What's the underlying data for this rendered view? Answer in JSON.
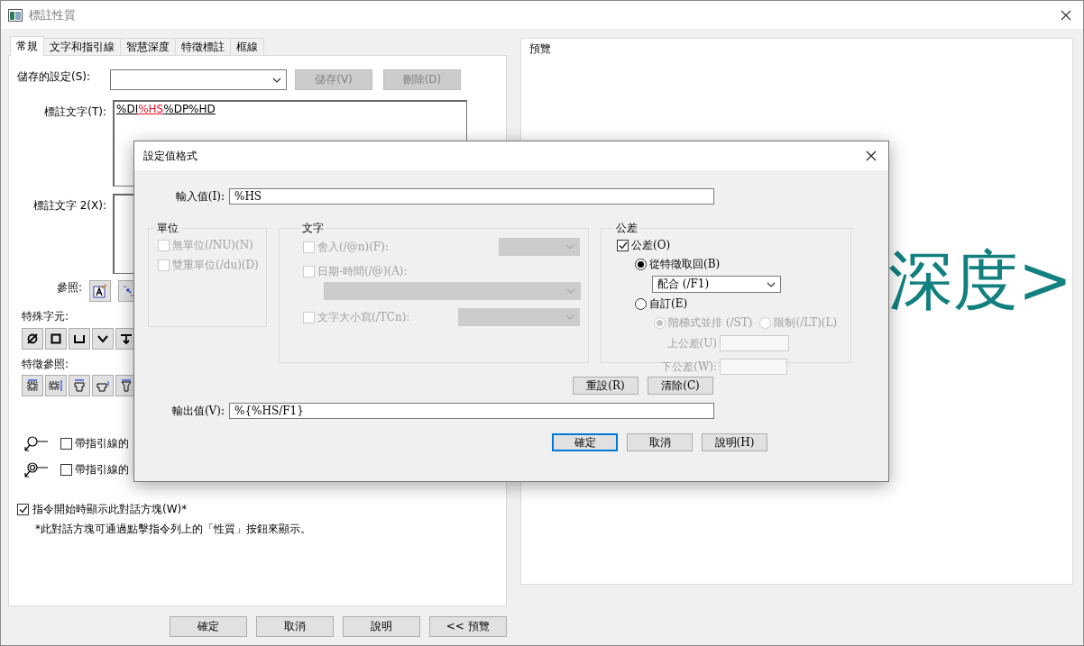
{
  "window": {
    "title": "標註性質"
  },
  "tabs": [
    {
      "label": "常規",
      "selected": true
    },
    {
      "label": "文字和指引線",
      "selected": false
    },
    {
      "label": "智慧深度",
      "selected": false
    },
    {
      "label": "特徵標註",
      "selected": false
    },
    {
      "label": "框線",
      "selected": false
    }
  ],
  "saved_settings": {
    "label": "儲存的設定(S):",
    "buttons": [
      {
        "label": "儲存(V)",
        "disabled": true
      },
      {
        "label": "刪除(D)",
        "disabled": true
      }
    ]
  },
  "callout_text": {
    "label": "標註文字(T):",
    "parts": [
      {
        "text": "%DI",
        "highlighted": false
      },
      {
        "text": "%HS",
        "highlighted": true
      },
      {
        "text": "%DP%HD",
        "highlighted": false
      }
    ]
  },
  "callout_text_2": {
    "label": "標註文字 2(X):"
  },
  "references": {
    "label": "參照:"
  },
  "special_characters": {
    "label": "特殊字元:"
  },
  "feature_references": {
    "label": "特徵參照:"
  },
  "leader_options": [
    {
      "label": "帶指引線的",
      "checked": false
    },
    {
      "label": "帶指引線的",
      "checked": false
    }
  ],
  "show_on_start": {
    "label": "指令開始時顯示此對話方塊(W)*",
    "checked": true
  },
  "note": "*此對話方塊可通過點擊指令列上的「性質」按鈕來顯示。",
  "footer_buttons": [
    {
      "label": "確定"
    },
    {
      "label": "取消"
    },
    {
      "label": "說明"
    },
    {
      "label": "<< 預覽"
    }
  ],
  "preview": {
    "title": "預覽",
    "sample_text": "深度>"
  },
  "format_dialog": {
    "title": "設定值格式",
    "input": {
      "label": "輸入值(I):",
      "value": "%HS"
    },
    "units": {
      "title": "單位",
      "options": [
        {
          "label": "無單位(/NU)(N)",
          "checked": false,
          "disabled": true
        },
        {
          "label": "雙重單位(/du)(D)",
          "checked": false,
          "disabled": true
        }
      ]
    },
    "text": {
      "title": "文字",
      "options": [
        {
          "kind": "inline",
          "label": "舍入(/@n)(F):",
          "checked": false,
          "disabled": true
        },
        {
          "kind": "below",
          "label": "日期-時間(/@)(A):",
          "checked": false,
          "disabled": true
        },
        {
          "kind": "inline",
          "label": "文字大小寫(/TCn):",
          "checked": false,
          "disabled": true
        }
      ]
    },
    "tolerance": {
      "title": "公差",
      "enabled": {
        "label": "公差(O)",
        "checked": true
      },
      "modes": [
        {
          "label": "從特徵取回(B)",
          "selected": true
        },
        {
          "label": "自訂(E)",
          "selected": false
        }
      ],
      "fit": {
        "value": "配合 (/F1)"
      },
      "styles": [
        {
          "label": "階梯式並排 (/ST)",
          "selected": true,
          "disabled": true
        },
        {
          "label": "限制(/LT)(L)",
          "selected": false,
          "disabled": true
        }
      ],
      "fields": [
        {
          "label": "上公差(U)",
          "disabled": true
        },
        {
          "label": "下公差(W):",
          "disabled": true
        }
      ]
    },
    "action_buttons": [
      {
        "label": "重設(R)"
      },
      {
        "label": "清除(C)"
      }
    ],
    "output": {
      "label": "輸出值(V):",
      "value": "%{%HS/F1}"
    },
    "buttons": [
      {
        "label": "確定",
        "default": true
      },
      {
        "label": "取消",
        "default": false
      },
      {
        "label": "說明(H)",
        "default": false
      }
    ]
  }
}
